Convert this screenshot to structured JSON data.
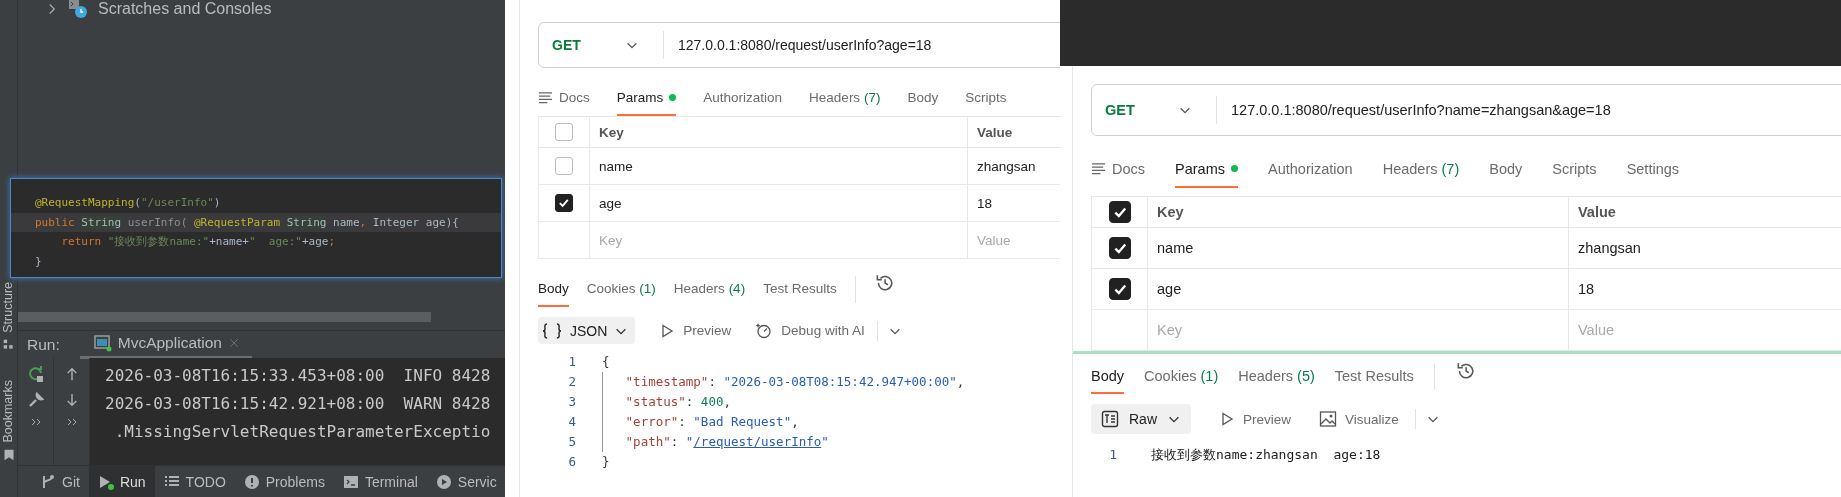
{
  "ide": {
    "tree": [
      {
        "label": "Scratches and Consoles"
      }
    ],
    "side_tabs": [
      {
        "label": "Structure",
        "kind": "structure"
      },
      {
        "label": "Bookmarks",
        "kind": "bookmarks"
      }
    ],
    "code_popup": {
      "lines": [
        {
          "current": false,
          "tokens": [
            {
              "kind": "annotation",
              "text": "@RequestMapping"
            },
            {
              "kind": "plain",
              "text": "("
            },
            {
              "kind": "string",
              "text": "\"/userInfo\""
            },
            {
              "kind": "plain",
              "text": ")"
            }
          ]
        },
        {
          "current": true,
          "tokens": [
            {
              "kind": "keyword",
              "text": "public "
            },
            {
              "kind": "highlight",
              "text": "String"
            },
            {
              "kind": "dim",
              "text": " userInfo( "
            },
            {
              "kind": "annotation",
              "text": "@RequestParam "
            },
            {
              "kind": "highlight",
              "text": "String"
            },
            {
              "kind": "plain",
              "text": " name"
            },
            {
              "kind": "keyword",
              "text": ","
            },
            {
              "kind": "plain",
              "text": " Integer age){"
            }
          ]
        },
        {
          "current": false,
          "tokens": [
            {
              "kind": "keyword",
              "text": "    return "
            },
            {
              "kind": "string",
              "text": "\"接收到参数name:\""
            },
            {
              "kind": "plain",
              "text": "+name+"
            },
            {
              "kind": "string",
              "text": "\"  age:\""
            },
            {
              "kind": "plain",
              "text": "+age"
            },
            {
              "kind": "keyword",
              "text": ";"
            }
          ]
        },
        {
          "current": false,
          "tokens": [
            {
              "kind": "plain",
              "text": "}"
            }
          ]
        }
      ]
    },
    "run_panel": {
      "label": "Run:",
      "tab": "MvcApplication",
      "console": [
        "2026-03-08T16:15:33.453+08:00  INFO 8428",
        "2026-03-08T16:15:42.921+08:00  WARN 8428",
        " .MissingServletRequestParameterExceptio"
      ]
    },
    "tool_windows": [
      {
        "label": "Git",
        "kind": "git",
        "selected": false
      },
      {
        "label": "Run",
        "kind": "run",
        "selected": true
      },
      {
        "label": "TODO",
        "kind": "todo",
        "selected": false
      },
      {
        "label": "Problems",
        "kind": "problems",
        "selected": false
      },
      {
        "label": "Terminal",
        "kind": "terminal",
        "selected": false
      },
      {
        "label": "Servic",
        "kind": "services",
        "selected": false
      }
    ]
  },
  "request_panels": [
    {
      "method": "GET",
      "url": "127.0.0.1:8080/request/userInfo?age=18",
      "tabs": [
        {
          "label": "Docs",
          "kind": "docs",
          "selected": false,
          "modified": false
        },
        {
          "label": "Params",
          "kind": "tab",
          "selected": true,
          "modified": true
        },
        {
          "label": "Authorization",
          "kind": "tab",
          "selected": false,
          "modified": false
        },
        {
          "label": "Headers",
          "count": "(7)",
          "kind": "tab",
          "selected": false,
          "modified": false
        },
        {
          "label": "Body",
          "kind": "tab",
          "selected": false,
          "modified": false
        },
        {
          "label": "Scripts",
          "kind": "tab",
          "selected": false,
          "modified": false
        }
      ],
      "params": {
        "all_checked": false,
        "columns": [
          "Key",
          "Value"
        ],
        "rows": [
          {
            "key": "name",
            "value": "zhangsan",
            "checked": false
          },
          {
            "key": "age",
            "value": "18",
            "checked": true
          }
        ],
        "new_row": {
          "key": {
            "placeholder": "Key"
          },
          "value": {
            "placeholder": "Value"
          }
        }
      },
      "response": {
        "tabs": [
          {
            "label": "Body",
            "selected": true
          },
          {
            "label": "Cookies",
            "count": "(1)",
            "selected": false
          },
          {
            "label": "Headers",
            "count": "(4)",
            "selected": false
          },
          {
            "label": "Test Results",
            "selected": false
          }
        ],
        "format": {
          "label": "JSON",
          "kind": "json"
        },
        "actions": [
          {
            "label": "Preview",
            "kind": "preview"
          },
          {
            "label": "Debug with AI",
            "kind": "debug"
          }
        ],
        "lines": [
          {
            "number": "1",
            "guide": false,
            "tokens": [
              {
                "kind": "punct",
                "text": "{"
              }
            ]
          },
          {
            "number": "2",
            "guide": true,
            "tokens": [
              {
                "kind": "key",
                "text": "\"timestamp\""
              },
              {
                "kind": "punct",
                "text": ": "
              },
              {
                "kind": "string",
                "text": "\"2026-03-08T08:15:42.947+00:00\""
              },
              {
                "kind": "punct",
                "text": ","
              }
            ]
          },
          {
            "number": "3",
            "guide": true,
            "tokens": [
              {
                "kind": "key",
                "text": "\"status\""
              },
              {
                "kind": "punct",
                "text": ": "
              },
              {
                "kind": "number",
                "text": "400"
              },
              {
                "kind": "punct",
                "text": ","
              }
            ]
          },
          {
            "number": "4",
            "guide": true,
            "tokens": [
              {
                "kind": "key",
                "text": "\"error\""
              },
              {
                "kind": "punct",
                "text": ": "
              },
              {
                "kind": "string",
                "text": "\"Bad Request\""
              },
              {
                "kind": "punct",
                "text": ","
              }
            ]
          },
          {
            "number": "5",
            "guide": true,
            "tokens": [
              {
                "kind": "key",
                "text": "\"path\""
              },
              {
                "kind": "punct",
                "text": ": "
              },
              {
                "kind": "string",
                "text": "\""
              },
              {
                "kind": "link",
                "text": "/request/userInfo"
              },
              {
                "kind": "string",
                "text": "\""
              }
            ]
          },
          {
            "number": "6",
            "guide": false,
            "tokens": [
              {
                "kind": "punct",
                "text": "}"
              }
            ]
          }
        ]
      }
    },
    {
      "method": "GET",
      "url": "127.0.0.1:8080/request/userInfo?name=zhangsan&age=18",
      "tabs": [
        {
          "label": "Docs",
          "kind": "docs",
          "selected": false,
          "modified": false
        },
        {
          "label": "Params",
          "kind": "tab",
          "selected": true,
          "modified": true
        },
        {
          "label": "Authorization",
          "kind": "tab",
          "selected": false,
          "modified": false
        },
        {
          "label": "Headers",
          "count": "(7)",
          "kind": "tab",
          "selected": false,
          "modified": false
        },
        {
          "label": "Body",
          "kind": "tab",
          "selected": false,
          "modified": false
        },
        {
          "label": "Scripts",
          "kind": "tab",
          "selected": false,
          "modified": false
        },
        {
          "label": "Settings",
          "kind": "tab",
          "selected": false,
          "modified": false
        }
      ],
      "params": {
        "all_checked": true,
        "columns": [
          "Key",
          "Value"
        ],
        "rows": [
          {
            "key": "name",
            "value": "zhangsan",
            "checked": true
          },
          {
            "key": "age",
            "value": "18",
            "checked": true
          }
        ],
        "new_row": {
          "key": {
            "placeholder": "Key"
          },
          "value": {
            "placeholder": "Value"
          }
        }
      },
      "response": {
        "tabs": [
          {
            "label": "Body",
            "selected": true
          },
          {
            "label": "Cookies",
            "count": "(1)",
            "selected": false
          },
          {
            "label": "Headers",
            "count": "(5)",
            "selected": false
          },
          {
            "label": "Test Results",
            "selected": false
          }
        ],
        "format": {
          "label": "Raw",
          "kind": "raw"
        },
        "actions": [
          {
            "label": "Preview",
            "kind": "preview"
          },
          {
            "label": "Visualize",
            "kind": "visualize"
          }
        ],
        "lines": [
          {
            "number": "1",
            "guide": false,
            "tokens": [
              {
                "kind": "text",
                "text": "接收到参数name:zhangsan  age:18"
              }
            ]
          }
        ]
      }
    }
  ]
}
